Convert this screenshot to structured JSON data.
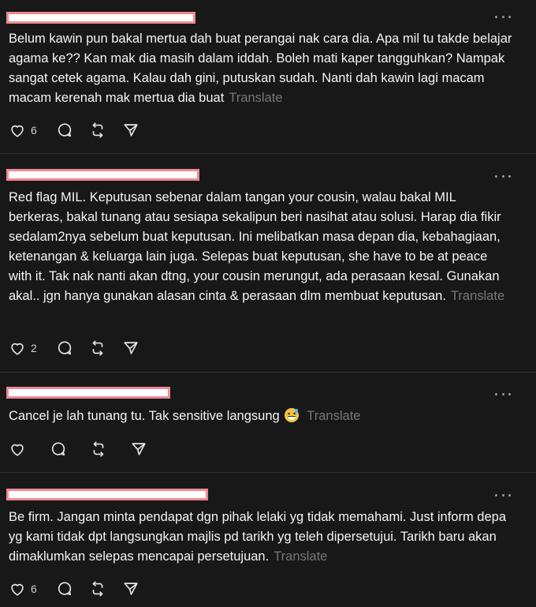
{
  "posts": [
    {
      "text": "Belum kawin pun bakal mertua dah buat perangai nak cara dia. Apa mil tu takde belajar agama ke?? Kan mak dia masih dalam iddah. Boleh mati kaper tangguhkan? Nampak sangat cetek agama. Kalau dah gini, putuskan sudah. Nanti dah kawin lagi macam macam kerenah mak mertua dia buat",
      "translate": "Translate",
      "likes": "6"
    },
    {
      "text": "Red flag MIL. Keputusan sebenar dalam tangan your cousin, walau bakal MIL berkeras, bakal tunang atau sesiapa sekalipun beri nasihat atau solusi. Harap dia fikir sedalam2nya sebelum buat keputusan. Ini melibatkan masa depan dia, kebahagiaan, ketenangan & keluarga lain juga. Selepas buat keputusan, she have to be at peace with it. Tak nak nanti akan dtng, your cousin merungut, ada perasaan kesal. Gunakan akal.. jgn hanya gunakan alasan cinta & perasaan dlm membuat keputusan.",
      "translate": "Translate",
      "likes": "2"
    },
    {
      "text": "Cancel je lah tunang tu. Tak sensitive langsung",
      "emoji": "grinning-face-with-sweat",
      "translate": "Translate",
      "likes": ""
    },
    {
      "text": "Be firm. Jangan minta pendapat dgn pihak lelaki yg tidak memahami. Just inform depa yg kami tidak dpt langsungkan majlis pd tarikh yg teleh dipersetujui. Tarikh baru akan dimaklumkan selepas mencapai persetujuan.",
      "translate": "Translate",
      "likes": "6"
    }
  ],
  "icons": {
    "like": "heart-icon",
    "reply": "comment-bubble-icon",
    "repost": "repost-icon",
    "share": "send-icon",
    "more": "more-options-icon"
  },
  "colors": {
    "background": "#181818",
    "text": "#f3f5f7",
    "muted": "#777777",
    "divider": "#323232",
    "redaction_fill": "#ffffff",
    "redaction_border": "#ee8a94"
  }
}
